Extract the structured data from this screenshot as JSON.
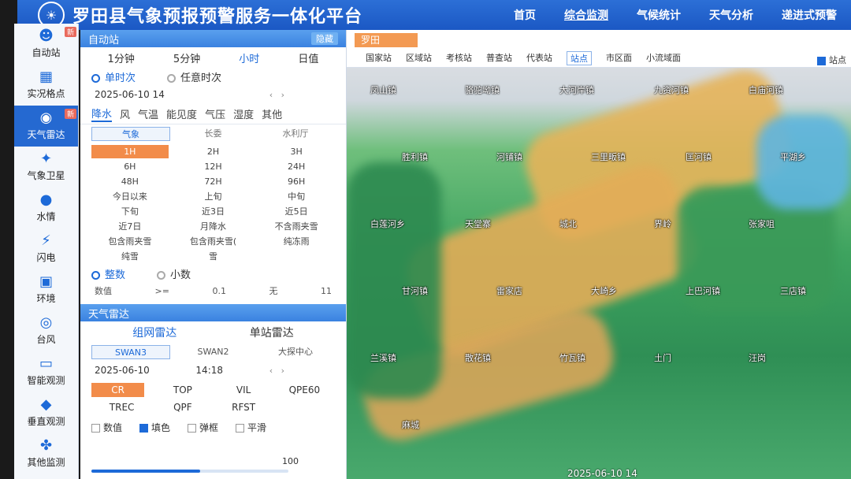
{
  "header": {
    "title": "罗田县气象预报预警服务一体化平台",
    "nav": [
      "首页",
      "综合监测",
      "气候统计",
      "天气分析",
      "递进式预警"
    ]
  },
  "sidebar": {
    "items": [
      {
        "label": "自动站",
        "badge": "新"
      },
      {
        "label": "实况格点",
        "badge": ""
      },
      {
        "label": "天气雷达",
        "badge": "新"
      },
      {
        "label": "气象卫星",
        "badge": ""
      },
      {
        "label": "水情",
        "badge": ""
      },
      {
        "label": "闪电",
        "badge": ""
      },
      {
        "label": "环境",
        "badge": ""
      },
      {
        "label": "台风",
        "badge": ""
      },
      {
        "label": "智能观测",
        "badge": ""
      },
      {
        "label": "垂直观测",
        "badge": ""
      },
      {
        "label": "其他监测",
        "badge": ""
      }
    ]
  },
  "auto_station": {
    "title": "自动站",
    "flag": "隐藏",
    "interval_tabs": [
      "1分钟",
      "5分钟",
      "小时",
      "日值"
    ],
    "time_modes": [
      "单时次",
      "任意时次"
    ],
    "datetime": "2025-06-10 14",
    "elements": [
      "降水",
      "风",
      "气温",
      "能见度",
      "气压",
      "湿度",
      "其他"
    ],
    "sources": [
      "气象",
      "长委",
      "水利厅"
    ],
    "periods": [
      "1H",
      "2H",
      "3H",
      "6H",
      "12H",
      "24H",
      "48H",
      "72H",
      "96H",
      "今日以来",
      "上旬",
      "中旬",
      "下旬",
      "近3日",
      "近5日",
      "近7日",
      "月降水",
      "不含雨夹雪",
      "包含雨夹雪",
      "包含雨夹雪(",
      "纯冻雨",
      "纯雪",
      "雪",
      ""
    ],
    "precision": [
      "整数",
      "小数"
    ],
    "value_label": "数值",
    "op": ">=",
    "min": "0.1",
    "mid": "无",
    "max": "11"
  },
  "radar": {
    "title": "天气雷达",
    "modes": [
      "组网雷达",
      "单站雷达"
    ],
    "sites": [
      "SWAN3",
      "SWAN2",
      "大探中心"
    ],
    "date": "2025-06-10",
    "time": "14:18",
    "products": [
      "CR",
      "TOP",
      "VIL",
      "QPE60",
      "TREC",
      "QPF",
      "RFST",
      ""
    ],
    "options": [
      "数值",
      "填色",
      "弹框",
      "平滑"
    ],
    "opacity_value": "100",
    "opacity_fraction": 0.55
  },
  "map_bar": {
    "region": "罗田",
    "layers": [
      "国家站",
      "区域站",
      "考核站",
      "普查站",
      "代表站",
      "站点",
      "市区面",
      "小流域面"
    ],
    "show_stations": "站点"
  },
  "map": {
    "towns": [
      "凤山镇",
      "骆驼坳镇",
      "大河岸镇",
      "九资河镇",
      "白庙河镇",
      "胜利镇",
      "河铺镇",
      "三里畈镇",
      "匡河镇",
      "平湖乡",
      "白莲河乡",
      "天堂寨",
      "城北",
      "界岭",
      "张家咀",
      "甘河镇",
      "雷家店",
      "大崎乡",
      "上巴河镇",
      "三店镇",
      "兰溪镇",
      "散花镇",
      "竹瓦镇",
      "土门",
      "汪岗",
      "麻城"
    ],
    "timestamp": "2025-06-10 14"
  },
  "colors": {
    "accent": "#1d6ad8",
    "active_orange": "#f28c4a",
    "header": "#1b58c4"
  }
}
